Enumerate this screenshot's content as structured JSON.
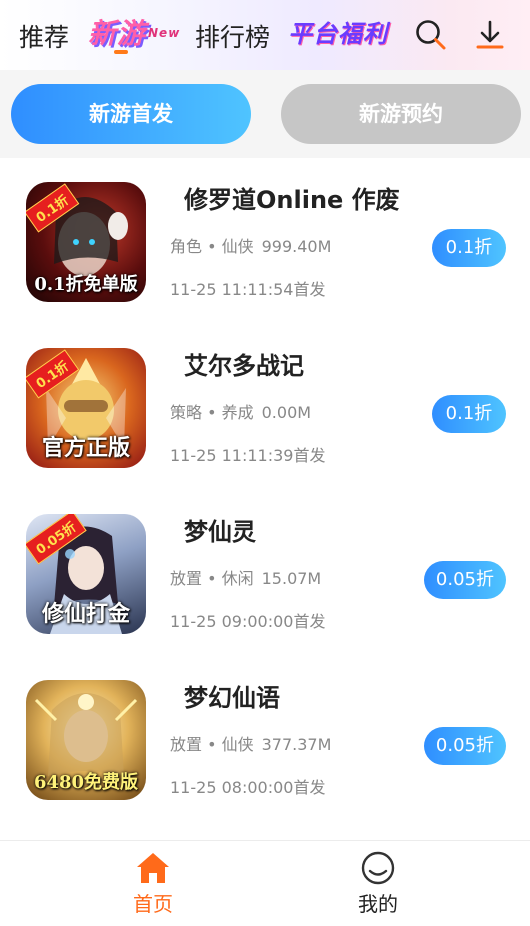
{
  "topnav": {
    "recommend_label": "推荐",
    "new_games_logo_text": "新游",
    "new_games_logo_sup": "New",
    "ranking_label": "排行榜",
    "platform_welfare_logo_text": "平台福利",
    "search_icon": "search-icon",
    "download_icon": "download-icon"
  },
  "tabs": [
    {
      "label": "新游首发",
      "active": true
    },
    {
      "label": "新游预约",
      "active": false
    }
  ],
  "games": [
    {
      "name": "修罗道Online 作废",
      "category": "角色 • 仙侠",
      "size": "999.40M",
      "date": "11-25 11:11:54首发",
      "discount": "0.1折",
      "thumb_badge": "0.1折",
      "thumb_caption": "0.1折免单版",
      "thumb_colors": [
        "#3a0a0a",
        "#8b1a1a"
      ]
    },
    {
      "name": "艾尔多战记",
      "category": "策略 • 养成",
      "size": "0.00M",
      "date": "11-25 11:11:39首发",
      "discount": "0.1折",
      "thumb_badge": "0.1折",
      "thumb_caption": "官方正版",
      "thumb_colors": [
        "#b81c1c",
        "#f0b23a"
      ]
    },
    {
      "name": "梦仙灵",
      "category": "放置 • 休闲",
      "size": "15.07M",
      "date": "11-25 09:00:00首发",
      "discount": "0.05折",
      "thumb_badge": "0.05折",
      "thumb_caption": "修仙打金",
      "thumb_colors": [
        "#1f2a44",
        "#7d8fb5"
      ]
    },
    {
      "name": "梦幻仙语",
      "category": "放置 • 仙侠",
      "size": "377.37M",
      "date": "11-25 08:00:00首发",
      "discount": "0.05折",
      "thumb_badge": "",
      "thumb_caption": "6480免费版",
      "thumb_colors": [
        "#8a5a1a",
        "#f3d48a"
      ]
    }
  ],
  "bottomnav": {
    "home_label": "首页",
    "mine_label": "我的",
    "active_color": "#ff6a1a"
  }
}
